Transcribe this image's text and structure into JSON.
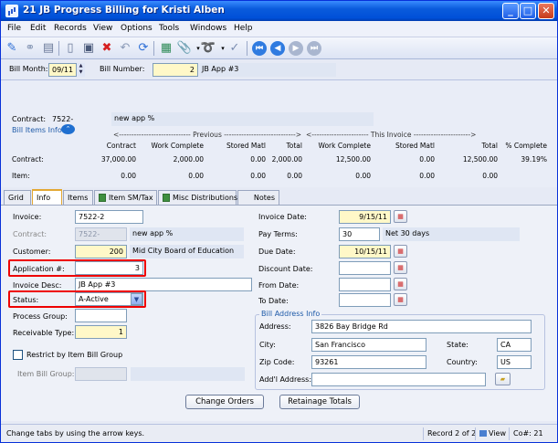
{
  "window": {
    "title": "21 JB Progress Billing for Kristi Alben"
  },
  "menu": [
    "File",
    "Edit",
    "Records",
    "View",
    "Options",
    "Tools",
    "Windows",
    "Help"
  ],
  "header": {
    "bill_month_label": "Bill Month:",
    "bill_month": "09/11",
    "bill_number_label": "Bill Number:",
    "bill_number": "2",
    "bill_desc": "JB App #3"
  },
  "bill_items": {
    "title": "Bill Items Info",
    "contract_label": "Contract:",
    "contract": "7522-",
    "contract_desc": "new app %",
    "previous_header": "<----------------------------- Previous ----------------------------->",
    "this_invoice_header": "<----------------------- This Invoice ----------------------->",
    "columns": [
      "Contract",
      "Work Complete",
      "Stored Matl",
      "Total",
      "Work Complete",
      "Stored Matl",
      "Total",
      "% Complete"
    ],
    "rows": [
      {
        "label": "Contract:",
        "values": [
          "37,000.00",
          "2,000.00",
          "0.00",
          "2,000.00",
          "12,500.00",
          "0.00",
          "12,500.00",
          "39.19%"
        ]
      },
      {
        "label": "Item:",
        "values": [
          "0.00",
          "0.00",
          "0.00",
          "0.00",
          "0.00",
          "0.00",
          "0.00",
          ""
        ]
      }
    ]
  },
  "tabs": [
    "Grid",
    "Info",
    "Items",
    "Item SM/Tax",
    "Misc Distributions",
    "Notes"
  ],
  "info": {
    "invoice_label": "Invoice:",
    "invoice": "7522-2",
    "contract_label": "Contract:",
    "contract": "7522-",
    "contract_desc": "new app %",
    "customer_label": "Customer:",
    "customer": "200",
    "customer_name": "Mid City Board of Education",
    "application_label": "Application #:",
    "application": "3",
    "invoice_desc_label": "Invoice Desc:",
    "invoice_desc": "JB App #3",
    "status_label": "Status:",
    "status": "A-Active",
    "process_group_label": "Process Group:",
    "process_group": "",
    "receivable_type_label": "Receivable Type:",
    "receivable_type": "1",
    "restrict_label": "Restrict by Item Bill Group",
    "item_bill_group_label": "Item Bill Group:",
    "invoice_date_label": "Invoice Date:",
    "invoice_date": "9/15/11",
    "pay_terms_label": "Pay Terms:",
    "pay_terms": "30",
    "pay_terms_desc": "Net 30 days",
    "due_date_label": "Due Date:",
    "due_date": "10/15/11",
    "discount_date_label": "Discount Date:",
    "discount_date": "",
    "from_date_label": "From Date:",
    "from_date": "",
    "to_date_label": "To Date:",
    "to_date": "",
    "bill_address_title": "Bill Address Info",
    "address_label": "Address:",
    "address": "3826 Bay Bridge Rd",
    "city_label": "City:",
    "city": "San Francisco",
    "state_label": "State:",
    "state": "CA",
    "zip_label": "Zip Code:",
    "zip": "93261",
    "country_label": "Country:",
    "country": "US",
    "addl_label": "Add'l Address:",
    "addl": ""
  },
  "buttons": {
    "change_orders": "Change Orders",
    "retainage_totals": "Retainage Totals"
  },
  "status_bar": {
    "hint": "Change tabs by using the arrow keys.",
    "record": "Record 2 of 2",
    "view": "View",
    "co": "Co#: 21"
  },
  "colors": {
    "highlight": "#e00000",
    "required_bg": "#fff8c8",
    "title_blue": "#0050d8"
  }
}
